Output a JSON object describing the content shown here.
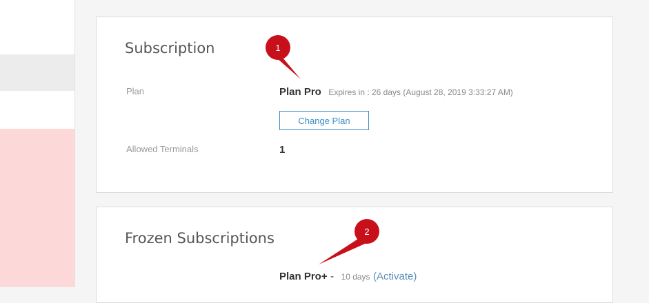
{
  "subscription": {
    "title": "Subscription",
    "plan_label": "Plan",
    "plan_name": "Plan Pro",
    "plan_expiry": "Expires in : 26 days (August 28, 2019 3:33:27 AM)",
    "change_plan_button": "Change Plan",
    "terminals_label": "Allowed Terminals",
    "terminals_value": "1"
  },
  "frozen": {
    "title": "Frozen Subscriptions",
    "plan_name": "Plan Pro+",
    "separator": "-",
    "days": "10 days",
    "activate_link": "(Activate)"
  },
  "annotations": {
    "marker1": "1",
    "marker2": "2",
    "marker_color": "#c8101a"
  },
  "colors": {
    "accent": "#3a8fc7",
    "link": "#5b8fb9",
    "sidebar_highlight": "#fdd8d8"
  }
}
